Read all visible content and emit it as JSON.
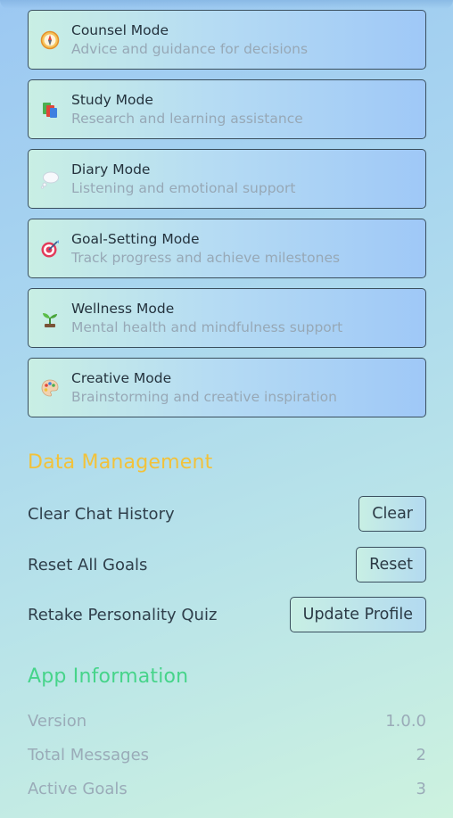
{
  "modes": [
    {
      "title": "Counsel Mode",
      "desc": "Advice and guidance for decisions",
      "icon": "compass-icon"
    },
    {
      "title": "Study Mode",
      "desc": "Research and learning assistance",
      "icon": "books-icon"
    },
    {
      "title": "Diary Mode",
      "desc": "Listening and emotional support",
      "icon": "thought-bubble-icon"
    },
    {
      "title": "Goal-Setting Mode",
      "desc": "Track progress and achieve milestones",
      "icon": "target-icon"
    },
    {
      "title": "Wellness Mode",
      "desc": "Mental health and mindfulness support",
      "icon": "seedling-icon"
    },
    {
      "title": "Creative Mode",
      "desc": "Brainstorming and creative inspiration",
      "icon": "palette-icon"
    }
  ],
  "data_management": {
    "title": "Data Management",
    "rows": [
      {
        "label": "Clear Chat History",
        "button": "Clear"
      },
      {
        "label": "Reset All Goals",
        "button": "Reset"
      },
      {
        "label": "Retake Personality Quiz",
        "button": "Update Profile"
      }
    ]
  },
  "app_info": {
    "title": "App Information",
    "rows": [
      {
        "label": "Version",
        "value": "1.0.0"
      },
      {
        "label": "Total Messages",
        "value": "2"
      },
      {
        "label": "Active Goals",
        "value": "3"
      }
    ]
  },
  "colors": {
    "data_title": "#f2c23a",
    "app_title": "#46d48a",
    "muted_text": "#9aabb8"
  }
}
